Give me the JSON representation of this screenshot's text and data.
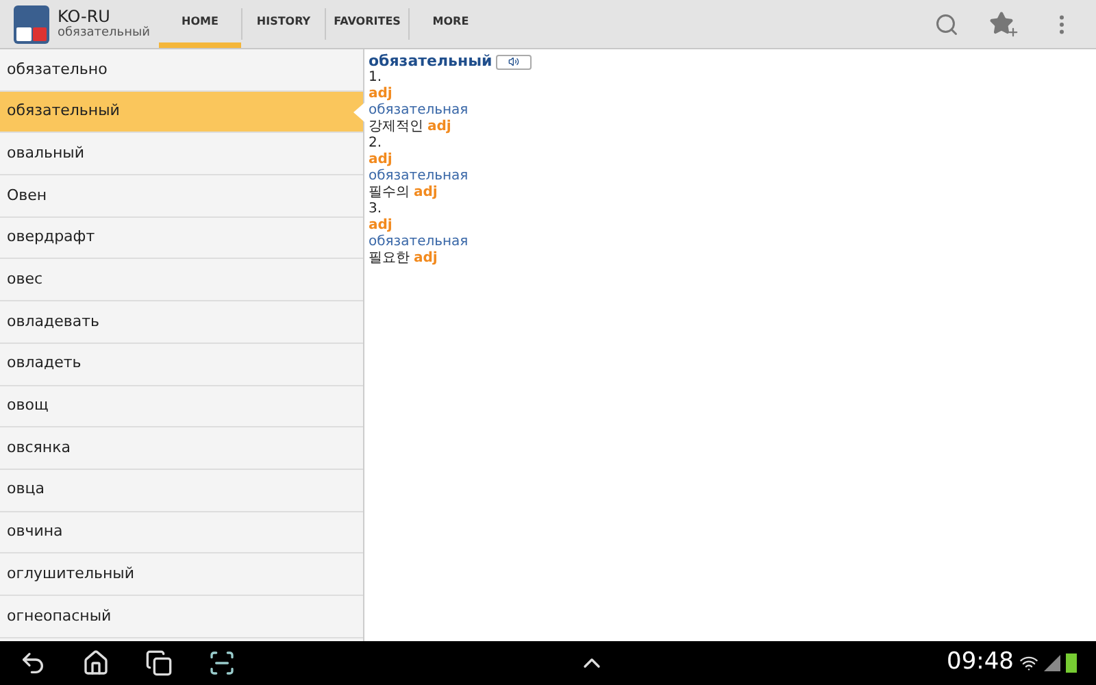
{
  "app": {
    "title": "KO-RU",
    "subtitle": "обязательный"
  },
  "tabs": [
    {
      "label": "HOME",
      "selected": true
    },
    {
      "label": "HISTORY",
      "selected": false
    },
    {
      "label": "FAVORITES",
      "selected": false
    },
    {
      "label": "MORE",
      "selected": false
    }
  ],
  "word_list": [
    {
      "label": "обязательно",
      "selected": false
    },
    {
      "label": "обязательный",
      "selected": true
    },
    {
      "label": "овальный",
      "selected": false
    },
    {
      "label": "Овен",
      "selected": false
    },
    {
      "label": "овердрафт",
      "selected": false
    },
    {
      "label": "овес",
      "selected": false
    },
    {
      "label": "овладевать",
      "selected": false
    },
    {
      "label": "овладеть",
      "selected": false
    },
    {
      "label": "овощ",
      "selected": false
    },
    {
      "label": "овсянка",
      "selected": false
    },
    {
      "label": "овца",
      "selected": false
    },
    {
      "label": "овчина",
      "selected": false
    },
    {
      "label": "оглушительный",
      "selected": false
    },
    {
      "label": "огнеопасный",
      "selected": false
    }
  ],
  "entry": {
    "headword": "обязательный",
    "senses": [
      {
        "number": "1.",
        "pos": "adj",
        "form": "обязательная",
        "translation": "강제적인",
        "translation_pos": "adj"
      },
      {
        "number": "2.",
        "pos": "adj",
        "form": "обязательная",
        "translation": "필수의",
        "translation_pos": "adj"
      },
      {
        "number": "3.",
        "pos": "adj",
        "form": "обязательная",
        "translation": "필요한",
        "translation_pos": "adj"
      }
    ]
  },
  "status_bar": {
    "time": "09:48"
  }
}
